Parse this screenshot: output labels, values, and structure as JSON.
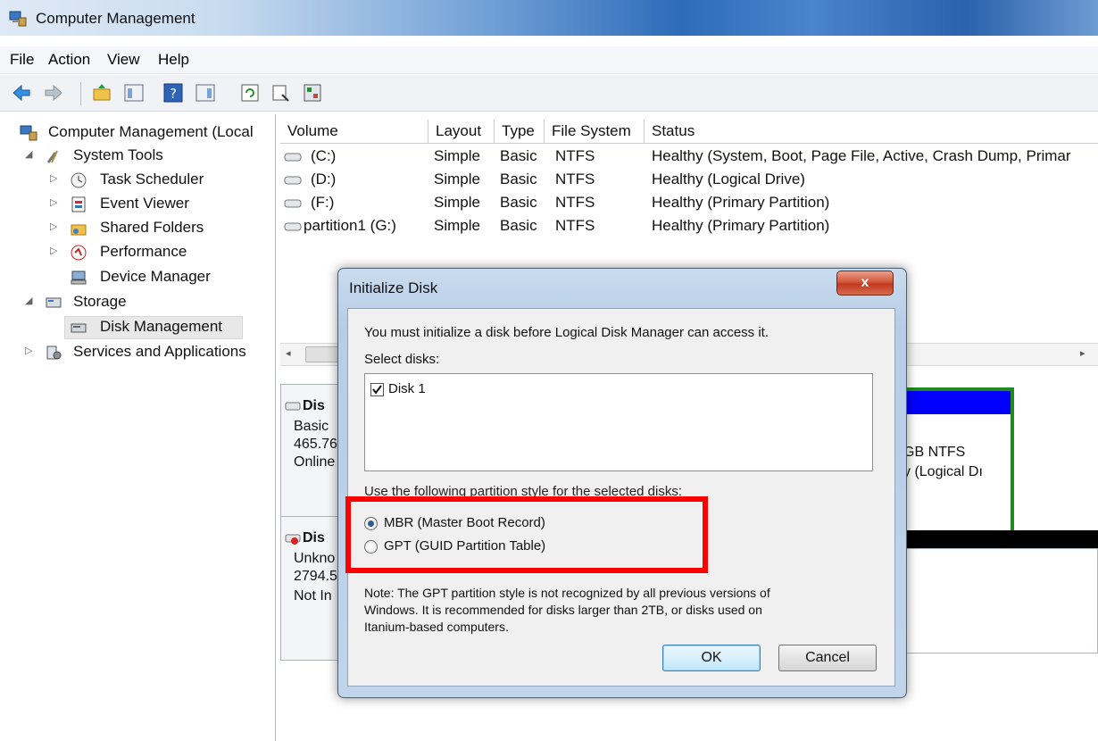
{
  "window": {
    "title": "Computer Management"
  },
  "menu": [
    "File",
    "Action",
    "View",
    "Help"
  ],
  "tree": {
    "root": "Computer Management (Local",
    "system_tools": "System Tools",
    "task_scheduler": "Task Scheduler",
    "event_viewer": "Event Viewer",
    "shared_folders": "Shared Folders",
    "performance": "Performance",
    "device_manager": "Device Manager",
    "storage": "Storage",
    "disk_management": "Disk Management",
    "services": "Services and Applications"
  },
  "volumes": {
    "columns": [
      "Volume",
      "Layout",
      "Type",
      "File System",
      "Status"
    ],
    "rows": [
      {
        "volume": "(C:)",
        "layout": "Simple",
        "type": "Basic",
        "fs": "NTFS",
        "status": "Healthy (System, Boot, Page File, Active, Crash Dump, Primar"
      },
      {
        "volume": "(D:)",
        "layout": "Simple",
        "type": "Basic",
        "fs": "NTFS",
        "status": "Healthy (Logical Drive)"
      },
      {
        "volume": "(F:)",
        "layout": "Simple",
        "type": "Basic",
        "fs": "NTFS",
        "status": "Healthy (Primary Partition)"
      },
      {
        "volume": "partition1 (G:)",
        "layout": "Simple",
        "type": "Basic",
        "fs": "NTFS",
        "status": "Healthy (Primary Partition)"
      }
    ]
  },
  "disks": {
    "d0": {
      "name": "Dis",
      "kind": "Basic",
      "size": "465.76",
      "state": "Online",
      "part_fs": "GB NTFS",
      "part_status": "y (Logical Dı"
    },
    "d1": {
      "name": "Dis",
      "kind": "Unkno",
      "size": "2794.5",
      "state": "Not In"
    }
  },
  "dialog": {
    "title": "Initialize Disk",
    "close": "x",
    "intro": "You must initialize a disk before Logical Disk Manager can access it.",
    "select_label": "Select disks:",
    "disks": [
      {
        "label": "Disk 1",
        "checked": true
      }
    ],
    "partition_label": "Use the following partition style for the selected disks:",
    "mbr": "MBR (Master Boot Record)",
    "gpt": "GPT (GUID Partition Table)",
    "selected": "mbr",
    "note1": "Note: The GPT partition style is not recognized by all previous versions of",
    "note2": "Windows. It is recommended for disks larger than 2TB, or disks used on",
    "note3": "Itanium-based computers.",
    "ok": "OK",
    "cancel": "Cancel"
  },
  "colors": {
    "highlight": "#ff0000",
    "titlebar_blue": "#2d6bb8",
    "close_red": "#c13a1e"
  }
}
